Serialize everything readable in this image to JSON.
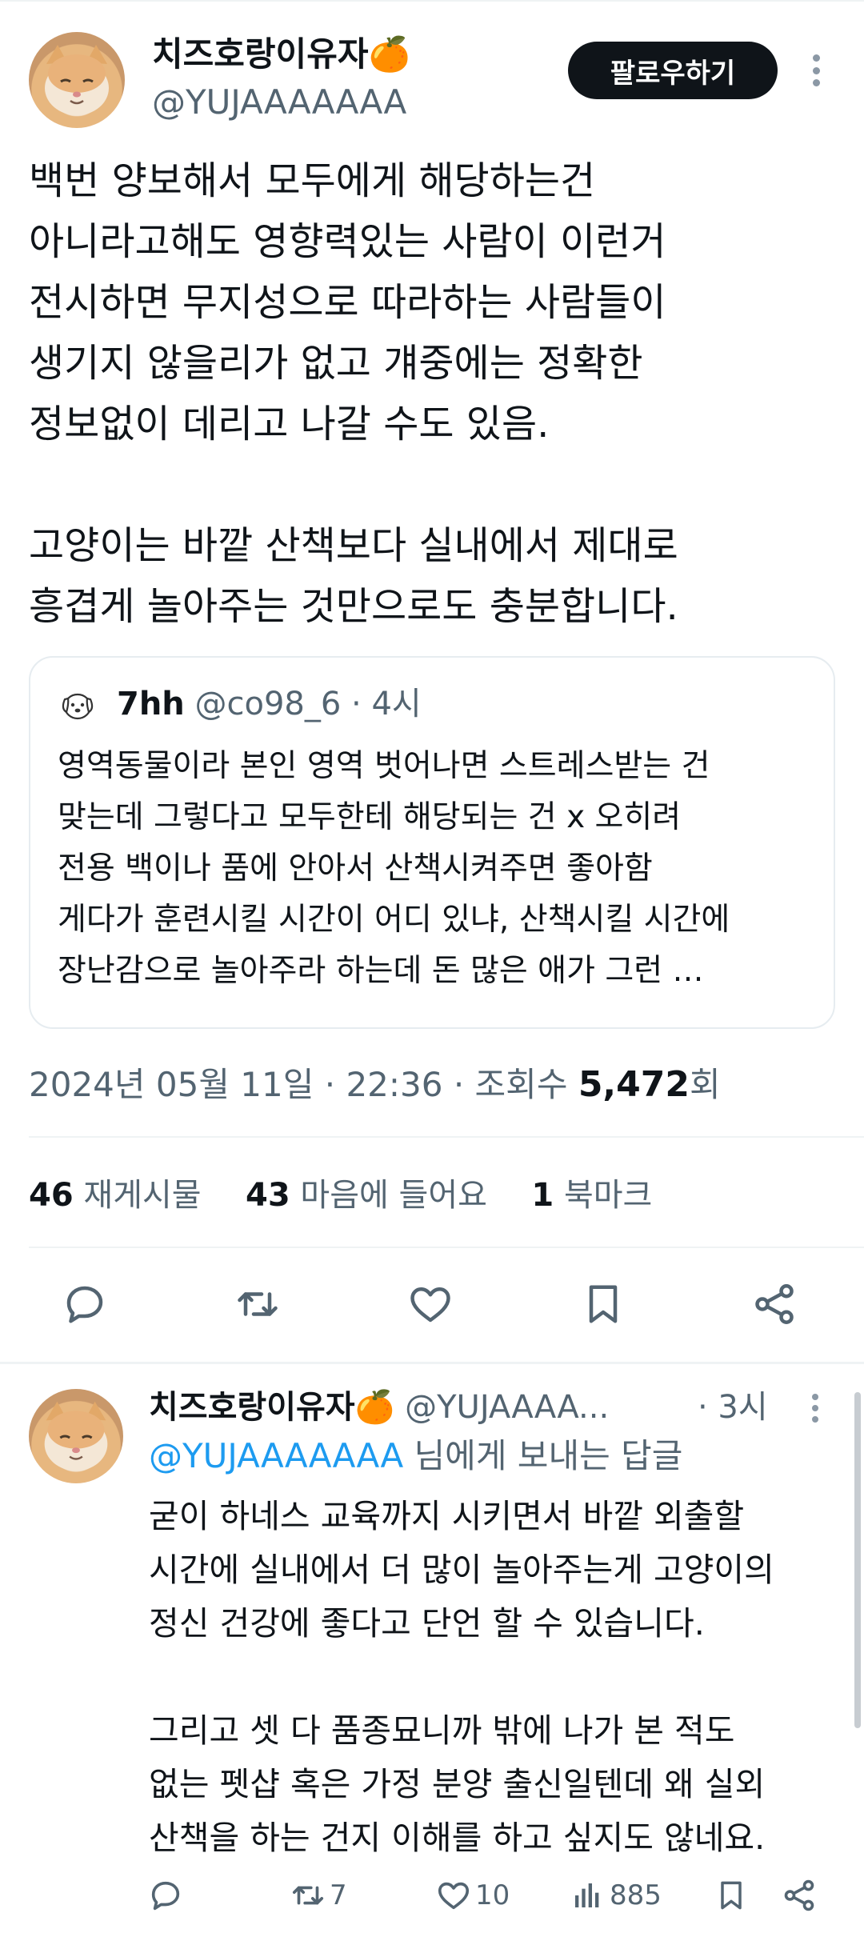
{
  "tweet": {
    "display_name": "치즈호랑이유자🍊",
    "handle": "@YUJAAAAAAA",
    "follow_label": "팔로우하기",
    "body": "백번 양보해서 모두에게 해당하는건\n아니라고해도 영향력있는 사람이 이런거\n전시하면 무지성으로 따라하는 사람들이\n생기지 않을리가 없고 걔중에는 정확한\n정보없이 데리고 나갈 수도 있음.\n\n고양이는 바깥 산책보다 실내에서 제대로\n흥겹게 놀아주는 것만으로도 충분합니다.",
    "quote": {
      "name": "7hh",
      "handle": "@co98_6",
      "time": "· 4시",
      "text": "영역동물이라 본인 영역 벗어나면 스트레스받는 건\n맞는데 그렇다고 모두한테 해당되는 건 x 오히려\n전용 백이나 품에 안아서 산책시켜주면 좋아함\n게다가 훈련시킬 시간이 어디 있냐, 산책시킬 시간에\n장난감으로 놀아주라 하는데 돈 많은 애가 그런 …"
    },
    "meta_prefix": "2024년 05월 11일 · 22:36 · 조회수 ",
    "views": "5,472",
    "views_suffix": "회",
    "stats": {
      "reposts_count": "46",
      "reposts_label": "재게시물",
      "likes_count": "43",
      "likes_label": "마음에 들어요",
      "bookmarks_count": "1",
      "bookmarks_label": "북마크"
    }
  },
  "reply": {
    "display_name": "치즈호랑이유자🍊",
    "handle": "@YUJAAAA...",
    "time": "· 3시",
    "reply_to_handle": "@YUJAAAAAAA",
    "reply_to_suffix": " 님에게 보내는 답글",
    "body": "굳이 하네스 교육까지 시키면서 바깥 외출할\n시간에 실내에서 더 많이 놀아주는게 고양이의\n정신 건강에 좋다고 단언 할 수 있습니다.\n\n그리고 셋 다 품종묘니까 밖에 나가 본 적도\n없는 펫샵 혹은 가정 분양 출신일텐데 왜 실외\n산책을 하는 건지 이해를 하고 싶지도 않네요.",
    "retweets": "7",
    "likes": "10",
    "views": "885"
  },
  "icons": {
    "reply": "reply-icon",
    "retweet": "retweet-icon",
    "like": "heart-icon",
    "bookmark": "bookmark-icon",
    "share": "share-icon",
    "views": "views-icon"
  },
  "colors": {
    "text": "#0f1419",
    "muted": "#536471",
    "link": "#1d9bf0",
    "button": "#0f1419"
  }
}
